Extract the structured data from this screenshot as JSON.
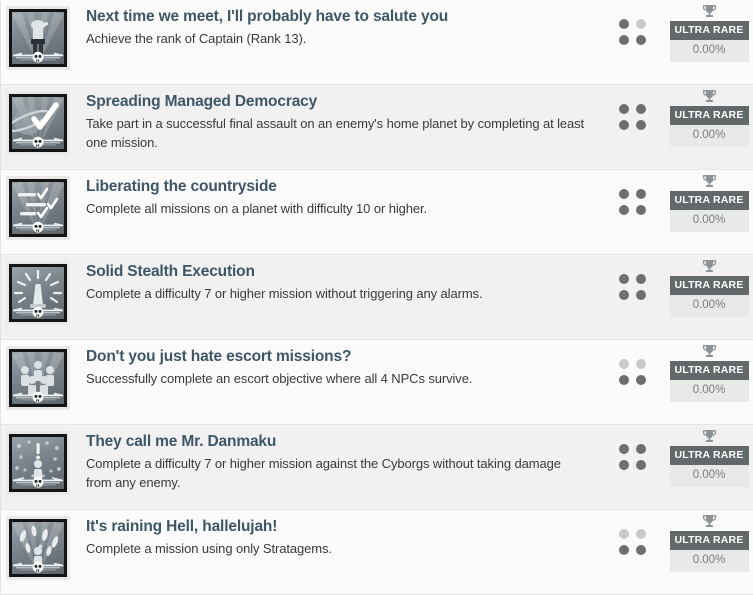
{
  "list": {
    "name": "trophy-achievement-list",
    "rarity_label": "ULTRA RARE",
    "rarity_percent": "0.00%",
    "rows": [
      {
        "title": "Next time we meet, I'll probably have to salute you",
        "description": "Achieve the rank of Captain (Rank 13).",
        "icon": "soldier-saluting-icon",
        "dots": [
          "on",
          "off",
          "on",
          "on"
        ],
        "rarity_label": "ULTRA RARE",
        "rarity_percent": "0.00%",
        "trophy_icon": "trophy-cup-icon"
      },
      {
        "title": "Spreading Managed Democracy",
        "description": "Take part in a successful final assault on an enemy's home planet by completing at least one mission.",
        "icon": "planet-checkmark-icon",
        "dots": [
          "on",
          "on",
          "on",
          "on"
        ],
        "rarity_label": "ULTRA RARE",
        "rarity_percent": "0.00%",
        "trophy_icon": "trophy-cup-icon"
      },
      {
        "title": "Liberating the countryside",
        "description": "Complete all missions on a planet with difficulty 10 or higher.",
        "icon": "checklist-icon",
        "dots": [
          "on",
          "on",
          "on",
          "on"
        ],
        "rarity_label": "ULTRA RARE",
        "rarity_percent": "0.00%",
        "trophy_icon": "trophy-cup-icon"
      },
      {
        "title": "Solid Stealth Execution",
        "description": "Complete a difficulty 7 or higher mission without triggering any alarms.",
        "icon": "alarm-siren-icon",
        "dots": [
          "on",
          "on",
          "on",
          "on"
        ],
        "rarity_label": "ULTRA RARE",
        "rarity_percent": "0.00%",
        "trophy_icon": "trophy-cup-icon"
      },
      {
        "title": "Don't you just hate escort missions?",
        "description": "Successfully complete an escort objective where all 4 NPCs survive.",
        "icon": "civilian-group-icon",
        "dots": [
          "off",
          "off",
          "on",
          "on"
        ],
        "rarity_label": "ULTRA RARE",
        "rarity_percent": "0.00%",
        "trophy_icon": "trophy-cup-icon"
      },
      {
        "title": "They call me Mr. Danmaku",
        "description": "Complete a difficulty 7 or higher mission against the Cyborgs without taking damage from any enemy.",
        "icon": "bullet-hell-icon",
        "dots": [
          "on",
          "on",
          "on",
          "on"
        ],
        "rarity_label": "ULTRA RARE",
        "rarity_percent": "0.00%",
        "trophy_icon": "trophy-cup-icon"
      },
      {
        "title": "It's raining Hell, hallelujah!",
        "description": "Complete a mission using only Stratagems.",
        "icon": "falling-bombs-icon",
        "dots": [
          "off",
          "off",
          "on",
          "on"
        ],
        "rarity_label": "ULTRA RARE",
        "rarity_percent": "0.00%",
        "trophy_icon": "trophy-cup-icon"
      }
    ]
  }
}
